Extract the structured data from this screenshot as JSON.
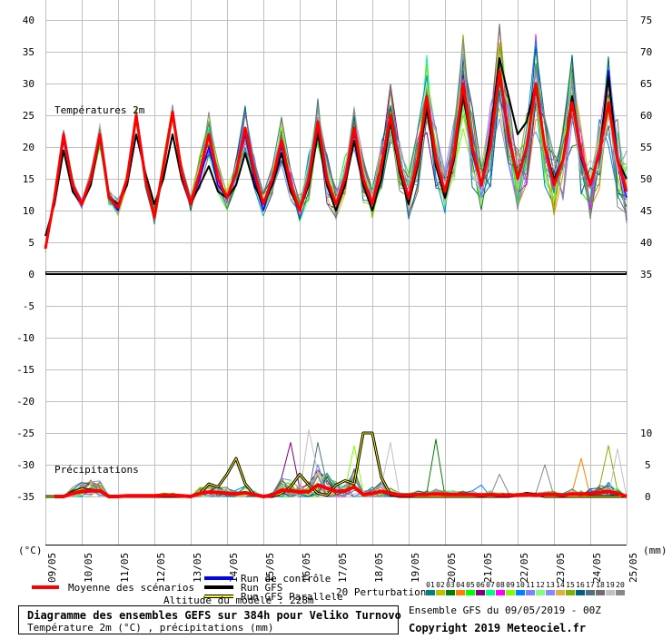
{
  "chart_data": {
    "type": "line",
    "title": "Diagramme des ensembles GEFS sur 384h pour Veliko Turnovo",
    "subtitle": "Température 2m (°C) , précipitations (mm)",
    "run_label": "Ensemble GFS du 09/05/2019 - 00Z",
    "copyright": "Copyright 2019 Meteociel.fr",
    "altitude": "Altitude du modèle : 228m",
    "temp_panel_label": "Températures 2m",
    "precip_panel_label": "Précipitations",
    "left_unit": "(°C)",
    "right_unit": "(mm)",
    "x_step_hours": 6,
    "x_ticks": [
      "09/05",
      "10/05",
      "11/05",
      "12/05",
      "13/05",
      "14/05",
      "15/05",
      "16/05",
      "17/05",
      "18/05",
      "19/05",
      "20/05",
      "21/05",
      "22/05",
      "23/05",
      "24/05",
      "25/05"
    ],
    "left_ticks": [
      40,
      35,
      30,
      25,
      20,
      15,
      10,
      5,
      0,
      -5,
      -10,
      -15,
      -20,
      -25,
      -30,
      -35
    ],
    "right_ticks_temp": [
      75,
      70,
      65,
      60,
      55,
      50,
      45,
      40,
      35
    ],
    "right_ticks_precip": [
      10,
      5,
      0
    ],
    "temp_ylim": [
      0,
      40
    ],
    "precip_ylim": [
      0,
      10
    ],
    "legend": {
      "mean": "Moyenne des scénarios",
      "control": "Run de contrôle",
      "gfs": "Run GFS",
      "parallel": "Run GFS Parallele",
      "perturbations": "20 Perturbations"
    },
    "perturbation_labels": [
      "01",
      "02",
      "03",
      "04",
      "05",
      "06",
      "07",
      "08",
      "09",
      "10",
      "11",
      "12",
      "13",
      "14",
      "15",
      "16",
      "17",
      "18",
      "19",
      "20"
    ],
    "perturbation_colors": [
      "#008080",
      "#c0c000",
      "#008000",
      "#ff8000",
      "#00ff00",
      "#800080",
      "#00ff80",
      "#ff00ff",
      "#80ff00",
      "#0080ff",
      "#8080ff",
      "#80ff80",
      "#8888ff",
      "#e0b040",
      "#80b000",
      "#006080",
      "#507080",
      "#786870",
      "#c0c0c0",
      "#888888"
    ],
    "colors": {
      "mean": "#ff0000",
      "control": "#0000ff",
      "gfs": "#000000",
      "parallel": "#ffff00"
    },
    "temperature": {
      "mean": [
        4,
        12,
        22,
        14,
        11,
        15,
        22,
        12,
        10.5,
        15,
        25,
        15,
        9,
        17,
        25.5,
        16,
        11,
        16,
        22,
        15,
        12,
        16,
        23,
        16,
        11,
        15,
        21,
        14,
        10,
        15,
        24,
        15,
        11,
        15,
        23,
        15,
        11,
        17,
        25,
        17,
        12,
        18,
        28,
        18,
        13,
        19,
        30,
        20,
        14,
        20,
        32,
        22,
        15,
        20,
        30,
        20,
        14,
        18,
        27,
        19,
        14,
        19,
        27,
        18,
        13
      ],
      "gfs": [
        6,
        11,
        19.5,
        13,
        11,
        14,
        21.5,
        12,
        11,
        14,
        22,
        16,
        11,
        15,
        22,
        15,
        11,
        14,
        17,
        13,
        12,
        14,
        19,
        14,
        11,
        14,
        19,
        13,
        10,
        14,
        22,
        14,
        10,
        14,
        21,
        14,
        10,
        15,
        24,
        16,
        11,
        17,
        26,
        17,
        12,
        18,
        28,
        20,
        14,
        22,
        34,
        28,
        22,
        24,
        30,
        20,
        15,
        18,
        28,
        19,
        14,
        19,
        31,
        18,
        15
      ],
      "control": [
        4,
        12,
        21,
        14,
        11,
        15,
        22,
        12,
        10,
        15,
        25,
        15,
        9,
        17,
        25,
        16,
        11,
        15,
        20,
        14,
        12,
        16,
        22,
        15,
        10,
        15,
        20,
        14,
        10,
        15,
        23,
        15,
        11,
        15,
        22,
        15,
        11,
        17,
        24,
        17,
        12,
        18,
        27,
        18,
        13,
        19,
        29,
        19,
        14,
        20,
        31,
        21,
        15,
        20,
        29,
        20,
        14,
        18,
        27,
        18,
        14,
        19,
        32,
        18,
        12
      ],
      "spread": [
        0.5,
        0.5,
        0.5,
        1,
        0.5,
        1,
        1.5,
        1,
        1,
        1,
        1,
        1,
        1,
        1,
        1,
        1,
        1,
        2,
        3,
        2,
        1.5,
        2,
        3,
        2,
        1.5,
        2,
        3,
        2,
        2,
        3,
        3,
        3,
        2,
        3,
        3,
        3,
        2,
        3,
        4,
        3,
        3,
        4,
        5,
        4,
        3,
        4,
        6,
        5,
        3,
        5,
        6,
        5,
        4,
        5,
        6,
        5,
        4,
        5,
        6,
        5,
        4,
        5,
        6,
        6,
        5
      ]
    },
    "precipitation": {
      "mean": [
        0,
        0,
        0,
        0.5,
        0.8,
        0.9,
        0.9,
        0,
        0,
        0.1,
        0.1,
        0.1,
        0.1,
        0.2,
        0.2,
        0.1,
        0,
        0.5,
        0.7,
        0.6,
        0.5,
        0.4,
        0.6,
        0.3,
        0,
        0.2,
        1.0,
        0.9,
        0.7,
        0.8,
        1.8,
        1.3,
        0.8,
        0.9,
        1.5,
        0.3,
        0.5,
        0.8,
        0.5,
        0.2,
        0.2,
        0.3,
        0.3,
        0.4,
        0.3,
        0.3,
        0.3,
        0.3,
        0.2,
        0.3,
        0.2,
        0.2,
        0.2,
        0.3,
        0.2,
        0.3,
        0.3,
        0.2,
        0.4,
        0.3,
        0.5,
        0.6,
        0.8,
        0.5,
        0
      ],
      "gfs": [
        0,
        0,
        0,
        0.7,
        1.2,
        1.0,
        0.8,
        0,
        0,
        0,
        0,
        0,
        0,
        0,
        0,
        0,
        0,
        0.5,
        2,
        1.5,
        3.5,
        6,
        2,
        0.3,
        0,
        0,
        0.5,
        1.5,
        3.5,
        1.8,
        0.5,
        0.2,
        1.8,
        2.5,
        2,
        10,
        10,
        3,
        0.3,
        0,
        0,
        0,
        0,
        0,
        0,
        0,
        0,
        0,
        0,
        0,
        0,
        0,
        0.2,
        0.5,
        0.3,
        0,
        0,
        0,
        0,
        0,
        0,
        0,
        0,
        0,
        0
      ],
      "spikes": [
        {
          "member": 6,
          "index": 27,
          "value": 8.5
        },
        {
          "member": 19,
          "index": 29,
          "value": 10.5
        },
        {
          "member": 17,
          "index": 30,
          "value": 8.5
        },
        {
          "member": 9,
          "index": 34,
          "value": 8
        },
        {
          "member": 19,
          "index": 38,
          "value": 8.5
        },
        {
          "member": 3,
          "index": 43,
          "value": 9
        },
        {
          "member": 20,
          "index": 50,
          "value": 3.5
        },
        {
          "member": 20,
          "index": 55,
          "value": 5
        },
        {
          "member": 4,
          "index": 59,
          "value": 6
        },
        {
          "member": 15,
          "index": 62,
          "value": 8
        },
        {
          "member": 19,
          "index": 63,
          "value": 7.5
        },
        {
          "member": 10,
          "index": 48,
          "value": 1.8
        }
      ]
    }
  }
}
